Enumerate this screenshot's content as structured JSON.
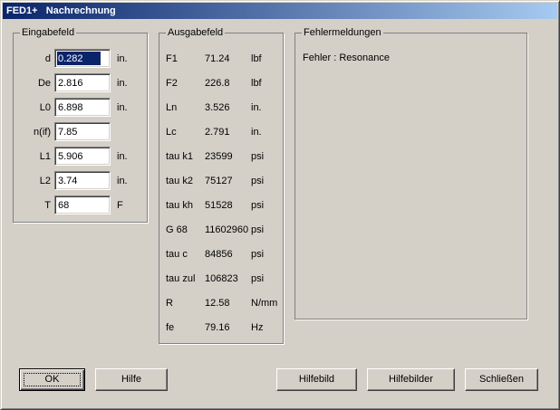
{
  "window": {
    "title": "FED1+   Nachrechnung"
  },
  "eingabe": {
    "title": "Eingabefeld",
    "rows": [
      {
        "label": "d",
        "value": "0.282",
        "unit": "in."
      },
      {
        "label": "De",
        "value": "2.816",
        "unit": "in."
      },
      {
        "label": "L0",
        "value": "6.898",
        "unit": "in."
      },
      {
        "label": "n(if)",
        "value": "7.85",
        "unit": ""
      },
      {
        "label": "L1",
        "value": "5.906",
        "unit": "in."
      },
      {
        "label": "L2",
        "value": "3.74",
        "unit": "in."
      },
      {
        "label": "T",
        "value": "68",
        "unit": "F"
      }
    ]
  },
  "ausgabe": {
    "title": "Ausgabefeld",
    "rows": [
      {
        "label": "F1",
        "value": "71.24",
        "unit": "lbf"
      },
      {
        "label": "F2",
        "value": "226.8",
        "unit": "lbf"
      },
      {
        "label": "Ln",
        "value": "3.526",
        "unit": "in."
      },
      {
        "label": "Lc",
        "value": "2.791",
        "unit": "in."
      },
      {
        "label": "tau k1",
        "value": "23599",
        "unit": "psi"
      },
      {
        "label": "tau k2",
        "value": "75127",
        "unit": "psi"
      },
      {
        "label": "tau kh",
        "value": "51528",
        "unit": "psi"
      },
      {
        "label": "G 68",
        "value": "11602960",
        "unit": "psi"
      },
      {
        "label": "tau c",
        "value": "84856",
        "unit": "psi"
      },
      {
        "label": "tau zul",
        "value": "106823",
        "unit": "psi"
      },
      {
        "label": "R",
        "value": "12.58",
        "unit": "N/mm"
      },
      {
        "label": "fe",
        "value": "79.16",
        "unit": "Hz"
      }
    ]
  },
  "fehler": {
    "title": "Fehlermeldungen",
    "message": "Fehler : Resonance"
  },
  "buttons": {
    "ok": "OK",
    "hilfe": "Hilfe",
    "hilfebild": "Hilfebild",
    "hilfebilder": "Hilfebilder",
    "schliessen": "Schließen"
  }
}
